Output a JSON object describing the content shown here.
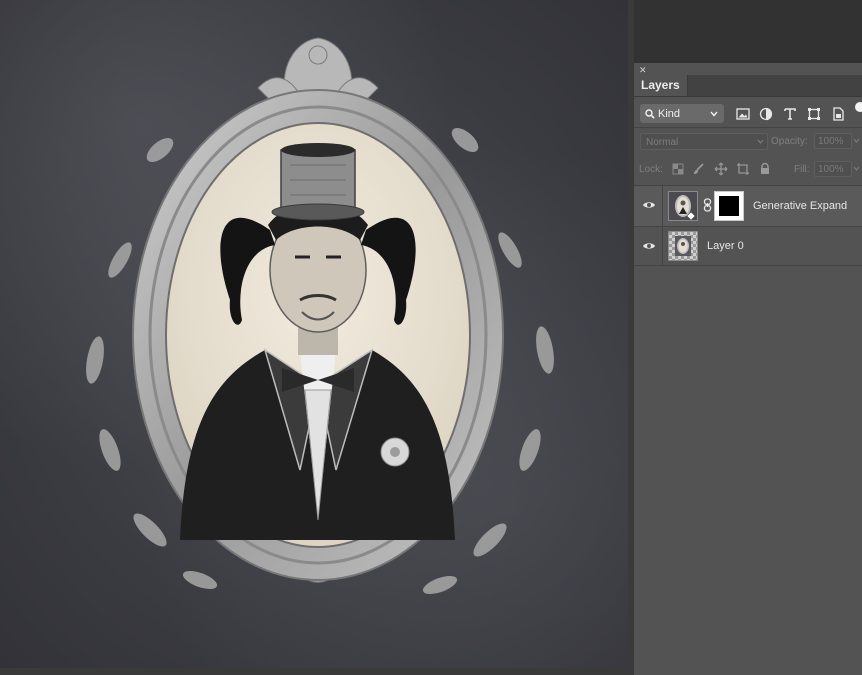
{
  "panel": {
    "tab_title": "Layers",
    "filter": {
      "kind_label": "Kind",
      "icons": [
        "image-filter-icon",
        "adjustment-filter-icon",
        "type-filter-icon",
        "shape-filter-icon",
        "smart-object-filter-icon"
      ]
    },
    "blend": {
      "mode": "Normal",
      "opacity_label": "Opacity:",
      "opacity_value": "100%"
    },
    "lock": {
      "label": "Lock:",
      "fill_label": "Fill:",
      "fill_value": "100%"
    },
    "layers": [
      {
        "name": "Generative Expand",
        "visible": true,
        "has_mask": true,
        "selected": true
      },
      {
        "name": "Layer 0",
        "visible": true,
        "has_mask": false,
        "selected": false
      }
    ]
  },
  "colors": {
    "panel_bg": "#535353",
    "tab_bg": "#424242",
    "canvas_bg": "#3b3b42"
  }
}
